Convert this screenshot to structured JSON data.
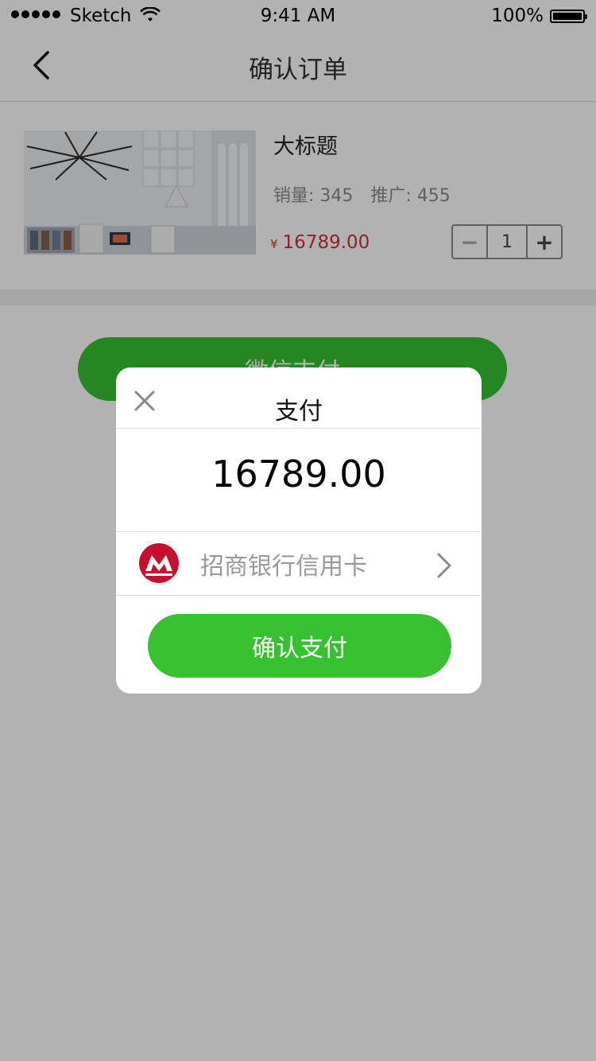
{
  "status_bar": {
    "carrier": "Sketch",
    "time": "9:41 AM",
    "battery_percent": "100%",
    "icons": [
      "signal-dots-icon",
      "wifi-icon",
      "battery-icon"
    ]
  },
  "nav": {
    "title": "确认订单",
    "back_icon": "chevron-left-icon"
  },
  "product": {
    "title": "大标题",
    "sales": "销量: 345",
    "promotion": "推广: 455",
    "currency_symbol": "¥",
    "price": "16789.00",
    "quantity": "1",
    "minus_label": "−",
    "plus_label": "+"
  },
  "wechat_pay_button": "微信支付",
  "dialog": {
    "title": "支付",
    "close_icon": "close-icon",
    "amount": "16789.00",
    "payment_method": "招商银行信用卡",
    "bank_icon": "cmb-bank-logo-icon",
    "chevron_icon": "chevron-right-icon",
    "confirm_label": "确认支付"
  },
  "colors": {
    "primary_green": "#37c030",
    "price_red": "#d0303a",
    "bank_red": "#c8102e",
    "overlay": "rgba(0,0,0,0.30)"
  }
}
